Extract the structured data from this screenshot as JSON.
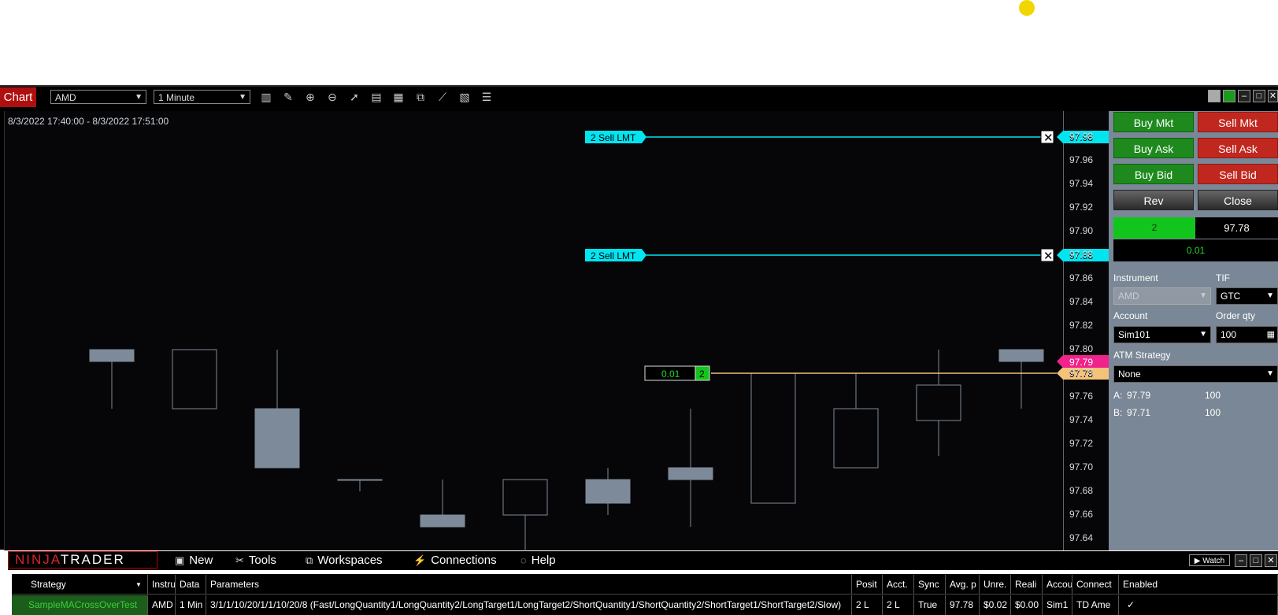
{
  "window": {
    "label": "Chart"
  },
  "toolbar": {
    "instrument": "AMD",
    "interval": "1 Minute",
    "icons": [
      "bars-icon",
      "pencil-icon",
      "zoom-in-icon",
      "zoom-out-icon",
      "pointer-icon",
      "data-box-icon",
      "properties-icon",
      "templates-icon",
      "strategies-icon",
      "indicators-icon",
      "list-icon"
    ]
  },
  "chart": {
    "date_range": "8/3/2022 17:40:00 - 8/3/2022 17:51:00",
    "ticks": [
      "97.98",
      "97.96",
      "97.94",
      "97.92",
      "97.90",
      "97.88",
      "97.86",
      "97.84",
      "97.82",
      "97.80",
      "97.78",
      "97.76",
      "97.74",
      "97.72",
      "97.70",
      "97.68",
      "97.66",
      "97.64"
    ],
    "orders": [
      {
        "qty": "2",
        "label": "Sell LMT",
        "price": "97.98"
      },
      {
        "qty": "2",
        "label": "Sell LMT",
        "price": "97.88"
      }
    ],
    "position": {
      "pnl": "0.01",
      "qty": "2",
      "price": "97.78"
    },
    "last_price": "97.79",
    "colors": {
      "order": "#00e5f0",
      "position": "#f4c27a",
      "last": "#f0238c",
      "candle": "#7d8a99"
    }
  },
  "chart_data": {
    "type": "candlestick",
    "interval": "1 Minute",
    "ylim": [
      97.63,
      97.99
    ],
    "candles": [
      {
        "o": 97.8,
        "h": 97.8,
        "l": 97.75,
        "c": 97.79
      },
      {
        "o": 97.75,
        "h": 97.8,
        "l": 97.75,
        "c": 97.8
      },
      {
        "o": 97.75,
        "h": 97.8,
        "l": 97.7,
        "c": 97.7
      },
      {
        "o": 97.69,
        "h": 97.69,
        "l": 97.68,
        "c": 97.69
      },
      {
        "o": 97.66,
        "h": 97.69,
        "l": 97.65,
        "c": 97.65
      },
      {
        "o": 97.66,
        "h": 97.69,
        "l": 97.61,
        "c": 97.69
      },
      {
        "o": 97.69,
        "h": 97.7,
        "l": 97.66,
        "c": 97.67
      },
      {
        "o": 97.7,
        "h": 97.75,
        "l": 97.65,
        "c": 97.69
      },
      {
        "o": 97.67,
        "h": 97.78,
        "l": 97.67,
        "c": 97.78
      },
      {
        "o": 97.7,
        "h": 97.78,
        "l": 97.7,
        "c": 97.75
      },
      {
        "o": 97.74,
        "h": 97.8,
        "l": 97.71,
        "c": 97.77
      },
      {
        "o": 97.8,
        "h": 97.8,
        "l": 97.75,
        "c": 97.79
      }
    ]
  },
  "panel": {
    "buy_mkt": "Buy Mkt",
    "sell_mkt": "Sell Mkt",
    "buy_ask": "Buy Ask",
    "sell_ask": "Sell Ask",
    "buy_bid": "Buy Bid",
    "sell_bid": "Sell Bid",
    "rev": "Rev",
    "close": "Close",
    "position_qty": "2",
    "position_price": "97.78",
    "pnl": "0.01",
    "instrument_label": "Instrument",
    "instrument_value": "AMD",
    "tif_label": "TIF",
    "tif_value": "GTC",
    "account_label": "Account",
    "account_value": "Sim101",
    "order_qty_label": "Order qty",
    "order_qty_value": "100",
    "atm_label": "ATM Strategy",
    "atm_value": "None",
    "ask_label": "A:",
    "ask_price": "97.79",
    "ask_size": "100",
    "bid_label": "B:",
    "bid_price": "97.71",
    "bid_size": "100"
  },
  "control_center": {
    "logo_ninja": "NINJA",
    "logo_trader": "TRADER",
    "menu": [
      "New",
      "Tools",
      "Workspaces",
      "Connections",
      "Help"
    ],
    "watch": "Watch"
  },
  "grid": {
    "headers": [
      "Strategy",
      "Instru",
      "Data",
      "Parameters",
      "Posit",
      "Acct.",
      "Sync",
      "Avg. p",
      "Unre.",
      "Reali",
      "Accou",
      "Connect",
      "Enabled"
    ],
    "row": [
      "SampleMACrossOverTest",
      "AMD",
      "1 Min",
      "3/1/1/10/20/1/1/10/20/8 (Fast/LongQuantity1/LongQuantity2/LongTarget1/LongTarget2/ShortQuantity1/ShortQuantity2/ShortTarget1/ShortTarget2/Slow)",
      "2 L",
      "2 L",
      "True",
      "97.78",
      "$0.02",
      "$0.00",
      "Sim1",
      "TD Ame",
      "✓"
    ]
  }
}
